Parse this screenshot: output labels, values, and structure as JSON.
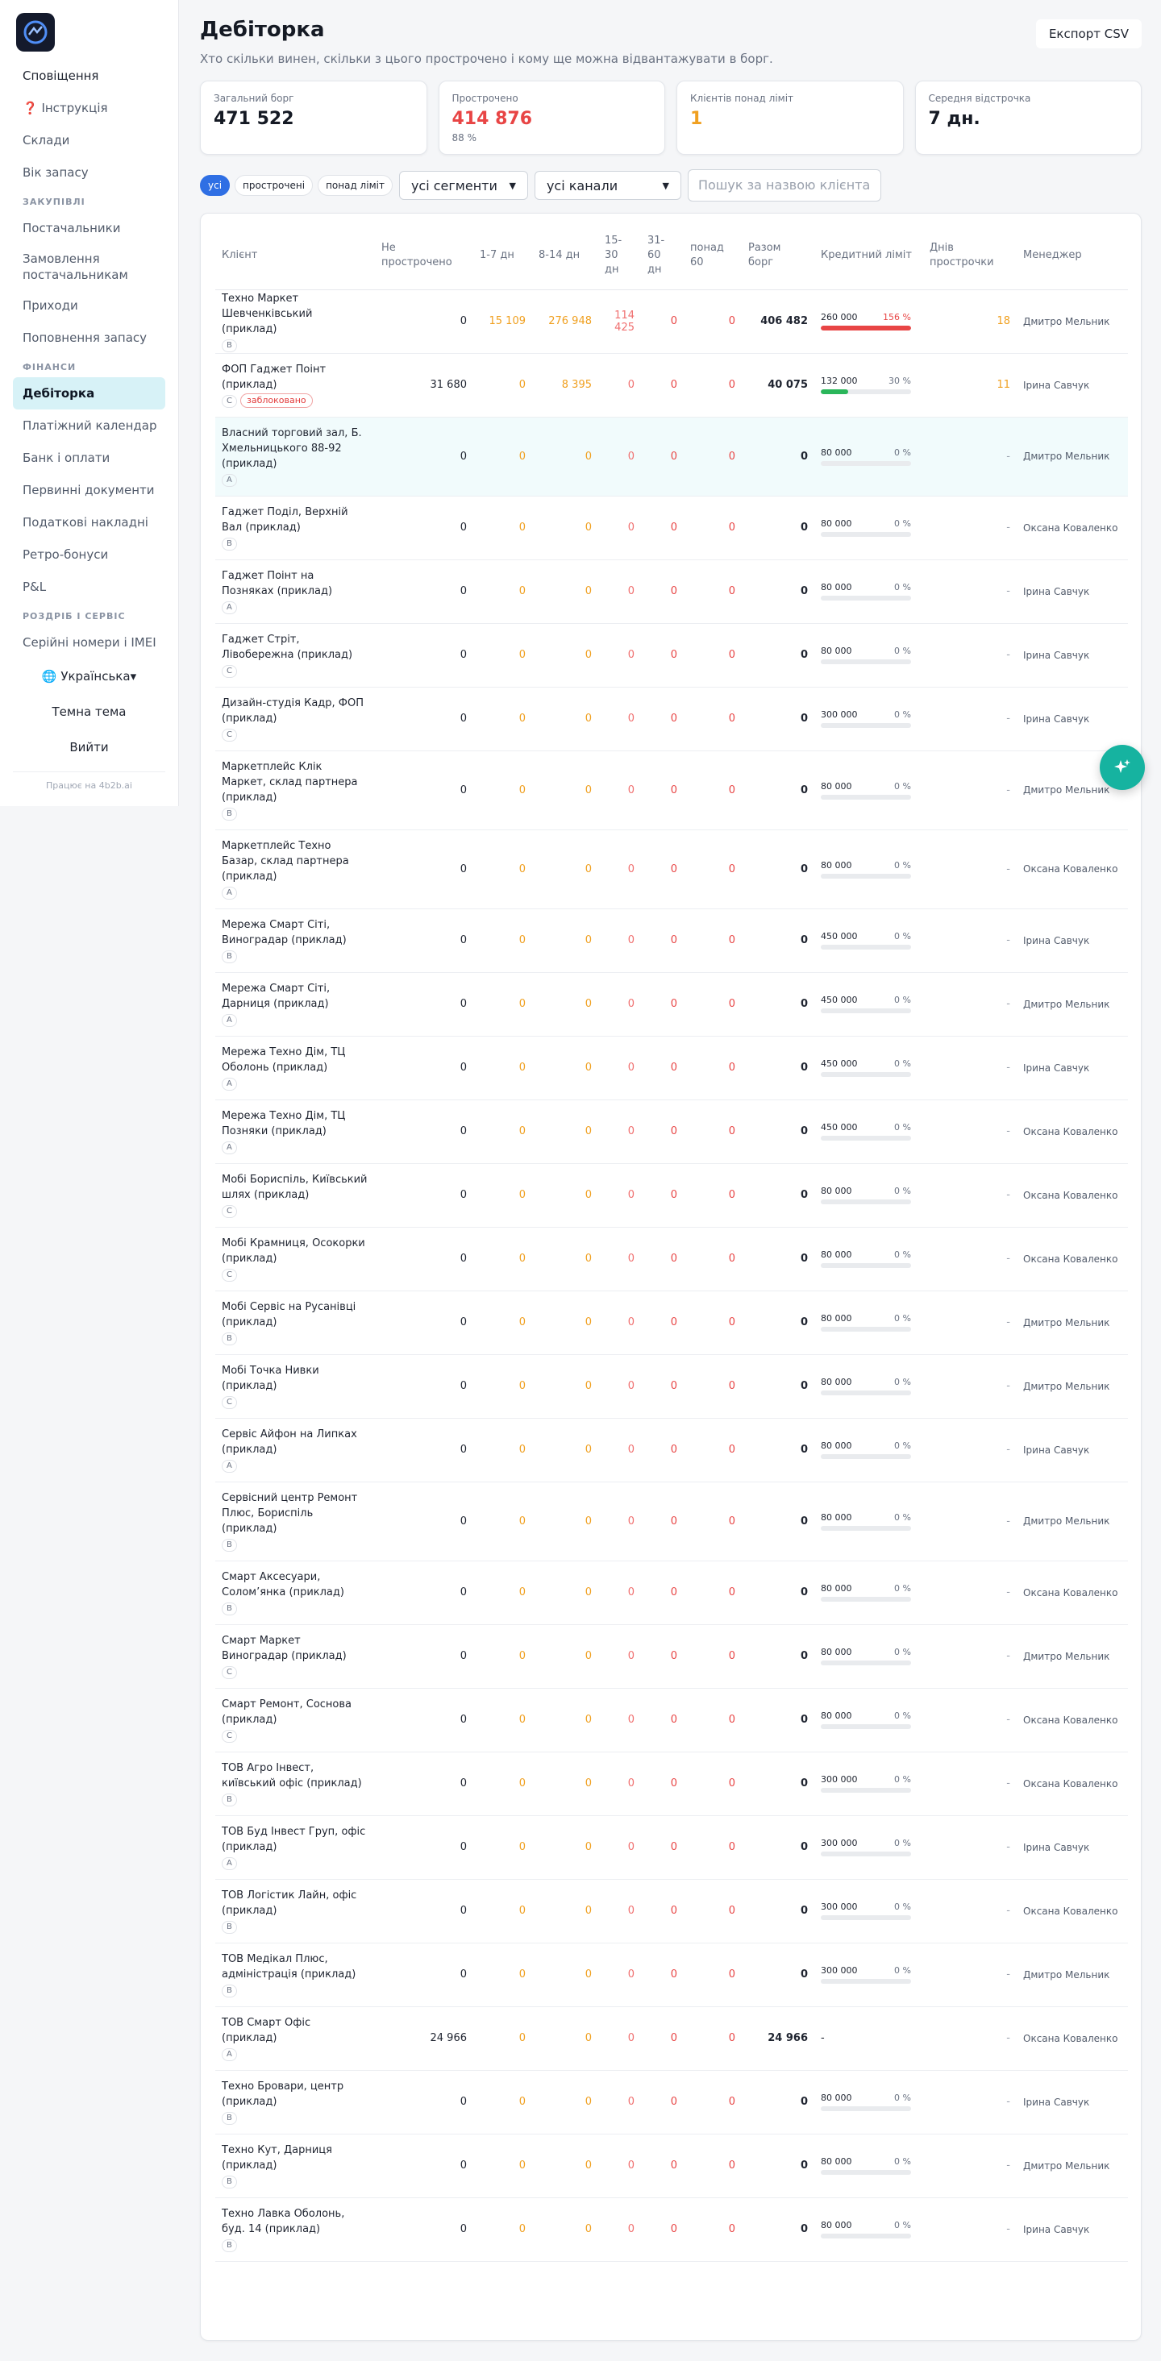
{
  "sidebar": {
    "top_items": [
      {
        "label": "Сповіщення"
      },
      {
        "label": "❓ Інструкція"
      },
      {
        "label": "Склади"
      },
      {
        "label": "Вік запасу"
      }
    ],
    "sections": {
      "procurement": "ЗАКУПІВЛІ",
      "finance": "ФІНАНСИ",
      "returns": "РОЗДРІБ І СЕРВІС"
    },
    "procurement_items": [
      {
        "label": "Постачальники"
      },
      {
        "label": "Замовлення постачальникам"
      },
      {
        "label": "Приходи"
      },
      {
        "label": "Поповнення запасу"
      }
    ],
    "finance_items": [
      {
        "label": "Дебіторка"
      },
      {
        "label": "Платіжний календар"
      },
      {
        "label": "Банк і оплати"
      },
      {
        "label": "Первинні документи"
      },
      {
        "label": "Податкові накладні"
      },
      {
        "label": "Ретро-бонуси"
      },
      {
        "label": "P&L"
      }
    ],
    "retail_items": [
      {
        "label": "Серійні номери і IMEI"
      }
    ],
    "language": "🌐 Українська▾",
    "theme": "Темна тема",
    "logout": "Вийти",
    "footer": "Працює на 4b2b.ai"
  },
  "header": {
    "title": "Дебіторка",
    "subtitle": "Хто скільки винен, скільки з цього прострочено і кому ще можна відвантажувати в борг.",
    "export": "Експорт CSV"
  },
  "kpis": [
    {
      "label": "Загальний борг",
      "value": "471 522",
      "sub": "",
      "color": "#151a24"
    },
    {
      "label": "Прострочено",
      "value": "414 876",
      "sub": "88 %",
      "color": "#e84545"
    },
    {
      "label": "Клієнтів понад ліміт",
      "value": "1",
      "sub": "",
      "color": "#f0a020"
    },
    {
      "label": "Середня відстрочка",
      "value": "7 дн.",
      "sub": "",
      "color": "#151a24"
    }
  ],
  "filters": {
    "pills": [
      {
        "label": "усі"
      },
      {
        "label": "прострочені"
      },
      {
        "label": "понад ліміт"
      }
    ],
    "segment": "усі сегменти",
    "channel": "усі канали",
    "search_placeholder": "Пошук за назвою клієнта"
  },
  "table": {
    "columns": [
      "Клієнт",
      "Не прострочено",
      "1-7 дн",
      "8-14 дн",
      "15-30 дн",
      "31-60 дн",
      "понад 60",
      "Разом борг",
      "Кредитний ліміт",
      "Днів прострочки",
      "Менеджер"
    ],
    "blocked_label": "заблоковано",
    "rows": [
      {
        "client": "Техно Маркет Шевченківський (приклад)",
        "seg": "B",
        "blocked": false,
        "nd": "0",
        "d1": "15 109",
        "d2": "276 948",
        "d3": "114 425",
        "d4": "0",
        "d5": "0",
        "total": "406 482",
        "limit": "260 000",
        "pct": "156 %",
        "ratio": 1.0,
        "days": "18",
        "manager": "Дмитро Мельник",
        "hi": false
      },
      {
        "client": "ФОП Гаджет Поінт (приклад)",
        "seg": "C",
        "blocked": true,
        "nd": "31 680",
        "d1": "0",
        "d2": "8 395",
        "d3": "0",
        "d4": "0",
        "d5": "0",
        "total": "40 075",
        "limit": "132 000",
        "pct": "30 %",
        "ratio": 0.3,
        "days": "11",
        "manager": "Ірина Савчук",
        "hi": false
      },
      {
        "client": "Власний торговий зал, Б. Хмельницького 88-92 (приклад)",
        "seg": "A",
        "blocked": false,
        "nd": "0",
        "d1": "0",
        "d2": "0",
        "d3": "0",
        "d4": "0",
        "d5": "0",
        "total": "0",
        "limit": "80 000",
        "pct": "0 %",
        "ratio": 0,
        "days": "-",
        "manager": "Дмитро Мельник",
        "hi": true
      },
      {
        "client": "Гаджет Поділ, Верхній Вал (приклад)",
        "seg": "B",
        "blocked": false,
        "nd": "0",
        "d1": "0",
        "d2": "0",
        "d3": "0",
        "d4": "0",
        "d5": "0",
        "total": "0",
        "limit": "80 000",
        "pct": "0 %",
        "ratio": 0,
        "days": "-",
        "manager": "Оксана Коваленко",
        "hi": false
      },
      {
        "client": "Гаджет Поінт на Позняках (приклад)",
        "seg": "A",
        "blocked": false,
        "nd": "0",
        "d1": "0",
        "d2": "0",
        "d3": "0",
        "d4": "0",
        "d5": "0",
        "total": "0",
        "limit": "80 000",
        "pct": "0 %",
        "ratio": 0,
        "days": "-",
        "manager": "Ірина Савчук",
        "hi": false
      },
      {
        "client": "Гаджет Стріт, Лівобережна (приклад)",
        "seg": "C",
        "blocked": false,
        "nd": "0",
        "d1": "0",
        "d2": "0",
        "d3": "0",
        "d4": "0",
        "d5": "0",
        "total": "0",
        "limit": "80 000",
        "pct": "0 %",
        "ratio": 0,
        "days": "-",
        "manager": "Ірина Савчук",
        "hi": false
      },
      {
        "client": "Дизайн-студія Кадр, ФОП (приклад)",
        "seg": "C",
        "blocked": false,
        "nd": "0",
        "d1": "0",
        "d2": "0",
        "d3": "0",
        "d4": "0",
        "d5": "0",
        "total": "0",
        "limit": "300 000",
        "pct": "0 %",
        "ratio": 0,
        "days": "-",
        "manager": "Ірина Савчук",
        "hi": false
      },
      {
        "client": "Маркетплейс Клік Маркет, склад партнера (приклад)",
        "seg": "B",
        "blocked": false,
        "nd": "0",
        "d1": "0",
        "d2": "0",
        "d3": "0",
        "d4": "0",
        "d5": "0",
        "total": "0",
        "limit": "80 000",
        "pct": "0 %",
        "ratio": 0,
        "days": "-",
        "manager": "Дмитро Мельник",
        "hi": false
      },
      {
        "client": "Маркетплейс Техно Базар, склад партнера (приклад)",
        "seg": "A",
        "blocked": false,
        "nd": "0",
        "d1": "0",
        "d2": "0",
        "d3": "0",
        "d4": "0",
        "d5": "0",
        "total": "0",
        "limit": "80 000",
        "pct": "0 %",
        "ratio": 0,
        "days": "-",
        "manager": "Оксана Коваленко",
        "hi": false
      },
      {
        "client": "Мережа Смарт Сіті, Виноградар (приклад)",
        "seg": "B",
        "blocked": false,
        "nd": "0",
        "d1": "0",
        "d2": "0",
        "d3": "0",
        "d4": "0",
        "d5": "0",
        "total": "0",
        "limit": "450 000",
        "pct": "0 %",
        "ratio": 0,
        "days": "-",
        "manager": "Ірина Савчук",
        "hi": false
      },
      {
        "client": "Мережа Смарт Сіті, Дарниця (приклад)",
        "seg": "A",
        "blocked": false,
        "nd": "0",
        "d1": "0",
        "d2": "0",
        "d3": "0",
        "d4": "0",
        "d5": "0",
        "total": "0",
        "limit": "450 000",
        "pct": "0 %",
        "ratio": 0,
        "days": "-",
        "manager": "Дмитро Мельник",
        "hi": false
      },
      {
        "client": "Мережа Техно Дім, ТЦ Оболонь (приклад)",
        "seg": "A",
        "blocked": false,
        "nd": "0",
        "d1": "0",
        "d2": "0",
        "d3": "0",
        "d4": "0",
        "d5": "0",
        "total": "0",
        "limit": "450 000",
        "pct": "0 %",
        "ratio": 0,
        "days": "-",
        "manager": "Ірина Савчук",
        "hi": false
      },
      {
        "client": "Мережа Техно Дім, ТЦ Позняки (приклад)",
        "seg": "A",
        "blocked": false,
        "nd": "0",
        "d1": "0",
        "d2": "0",
        "d3": "0",
        "d4": "0",
        "d5": "0",
        "total": "0",
        "limit": "450 000",
        "pct": "0 %",
        "ratio": 0,
        "days": "-",
        "manager": "Оксана Коваленко",
        "hi": false
      },
      {
        "client": "Мобі Бориспіль, Київський шлях (приклад)",
        "seg": "C",
        "blocked": false,
        "nd": "0",
        "d1": "0",
        "d2": "0",
        "d3": "0",
        "d4": "0",
        "d5": "0",
        "total": "0",
        "limit": "80 000",
        "pct": "0 %",
        "ratio": 0,
        "days": "-",
        "manager": "Оксана Коваленко",
        "hi": false
      },
      {
        "client": "Мобі Крамниця, Осокорки (приклад)",
        "seg": "C",
        "blocked": false,
        "nd": "0",
        "d1": "0",
        "d2": "0",
        "d3": "0",
        "d4": "0",
        "d5": "0",
        "total": "0",
        "limit": "80 000",
        "pct": "0 %",
        "ratio": 0,
        "days": "-",
        "manager": "Оксана Коваленко",
        "hi": false
      },
      {
        "client": "Мобі Сервіс на Русанівці (приклад)",
        "seg": "B",
        "blocked": false,
        "nd": "0",
        "d1": "0",
        "d2": "0",
        "d3": "0",
        "d4": "0",
        "d5": "0",
        "total": "0",
        "limit": "80 000",
        "pct": "0 %",
        "ratio": 0,
        "days": "-",
        "manager": "Дмитро Мельник",
        "hi": false
      },
      {
        "client": "Мобі Точка Нивки (приклад)",
        "seg": "C",
        "blocked": false,
        "nd": "0",
        "d1": "0",
        "d2": "0",
        "d3": "0",
        "d4": "0",
        "d5": "0",
        "total": "0",
        "limit": "80 000",
        "pct": "0 %",
        "ratio": 0,
        "days": "-",
        "manager": "Дмитро Мельник",
        "hi": false
      },
      {
        "client": "Сервіс Айфон на Липках (приклад)",
        "seg": "A",
        "blocked": false,
        "nd": "0",
        "d1": "0",
        "d2": "0",
        "d3": "0",
        "d4": "0",
        "d5": "0",
        "total": "0",
        "limit": "80 000",
        "pct": "0 %",
        "ratio": 0,
        "days": "-",
        "manager": "Ірина Савчук",
        "hi": false
      },
      {
        "client": "Сервісний центр Ремонт Плюс, Бориспіль (приклад)",
        "seg": "B",
        "blocked": false,
        "nd": "0",
        "d1": "0",
        "d2": "0",
        "d3": "0",
        "d4": "0",
        "d5": "0",
        "total": "0",
        "limit": "80 000",
        "pct": "0 %",
        "ratio": 0,
        "days": "-",
        "manager": "Дмитро Мельник",
        "hi": false
      },
      {
        "client": "Смарт Аксесуари, Солом’янка (приклад)",
        "seg": "B",
        "blocked": false,
        "nd": "0",
        "d1": "0",
        "d2": "0",
        "d3": "0",
        "d4": "0",
        "d5": "0",
        "total": "0",
        "limit": "80 000",
        "pct": "0 %",
        "ratio": 0,
        "days": "-",
        "manager": "Оксана Коваленко",
        "hi": false
      },
      {
        "client": "Смарт Маркет Виноградар (приклад)",
        "seg": "C",
        "blocked": false,
        "nd": "0",
        "d1": "0",
        "d2": "0",
        "d3": "0",
        "d4": "0",
        "d5": "0",
        "total": "0",
        "limit": "80 000",
        "pct": "0 %",
        "ratio": 0,
        "days": "-",
        "manager": "Дмитро Мельник",
        "hi": false
      },
      {
        "client": "Смарт Ремонт, Соснова (приклад)",
        "seg": "C",
        "blocked": false,
        "nd": "0",
        "d1": "0",
        "d2": "0",
        "d3": "0",
        "d4": "0",
        "d5": "0",
        "total": "0",
        "limit": "80 000",
        "pct": "0 %",
        "ratio": 0,
        "days": "-",
        "manager": "Оксана Коваленко",
        "hi": false
      },
      {
        "client": "ТОВ Агро Інвест, київський офіс (приклад)",
        "seg": "B",
        "blocked": false,
        "nd": "0",
        "d1": "0",
        "d2": "0",
        "d3": "0",
        "d4": "0",
        "d5": "0",
        "total": "0",
        "limit": "300 000",
        "pct": "0 %",
        "ratio": 0,
        "days": "-",
        "manager": "Оксана Коваленко",
        "hi": false
      },
      {
        "client": "ТОВ Буд Інвест Груп, офіс (приклад)",
        "seg": "A",
        "blocked": false,
        "nd": "0",
        "d1": "0",
        "d2": "0",
        "d3": "0",
        "d4": "0",
        "d5": "0",
        "total": "0",
        "limit": "300 000",
        "pct": "0 %",
        "ratio": 0,
        "days": "-",
        "manager": "Ірина Савчук",
        "hi": false
      },
      {
        "client": "ТОВ Логістик Лайн, офіс (приклад)",
        "seg": "B",
        "blocked": false,
        "nd": "0",
        "d1": "0",
        "d2": "0",
        "d3": "0",
        "d4": "0",
        "d5": "0",
        "total": "0",
        "limit": "300 000",
        "pct": "0 %",
        "ratio": 0,
        "days": "-",
        "manager": "Оксана Коваленко",
        "hi": false
      },
      {
        "client": "ТОВ Медікал Плюс, адміністрація (приклад)",
        "seg": "B",
        "blocked": false,
        "nd": "0",
        "d1": "0",
        "d2": "0",
        "d3": "0",
        "d4": "0",
        "d5": "0",
        "total": "0",
        "limit": "300 000",
        "pct": "0 %",
        "ratio": 0,
        "days": "-",
        "manager": "Дмитро Мельник",
        "hi": false
      },
      {
        "client": "ТОВ Смарт Офіс (приклад)",
        "seg": "A",
        "blocked": false,
        "nd": "24 966",
        "d1": "0",
        "d2": "0",
        "d3": "0",
        "d4": "0",
        "d5": "0",
        "total": "24 966",
        "limit": "-",
        "pct": "",
        "ratio": null,
        "days": "-",
        "manager": "Оксана Коваленко",
        "hi": false
      },
      {
        "client": "Техно Бровари, центр (приклад)",
        "seg": "B",
        "blocked": false,
        "nd": "0",
        "d1": "0",
        "d2": "0",
        "d3": "0",
        "d4": "0",
        "d5": "0",
        "total": "0",
        "limit": "80 000",
        "pct": "0 %",
        "ratio": 0,
        "days": "-",
        "manager": "Ірина Савчук",
        "hi": false
      },
      {
        "client": "Техно Кут, Дарниця (приклад)",
        "seg": "B",
        "blocked": false,
        "nd": "0",
        "d1": "0",
        "d2": "0",
        "d3": "0",
        "d4": "0",
        "d5": "0",
        "total": "0",
        "limit": "80 000",
        "pct": "0 %",
        "ratio": 0,
        "days": "-",
        "manager": "Дмитро Мельник",
        "hi": false
      },
      {
        "client": "Техно Лавка Оболонь, буд. 14 (приклад)",
        "seg": "B",
        "blocked": false,
        "nd": "0",
        "d1": "0",
        "d2": "0",
        "d3": "0",
        "d4": "0",
        "d5": "0",
        "total": "0",
        "limit": "80 000",
        "pct": "0 %",
        "ratio": 0,
        "days": "-",
        "manager": "Ірина Савчук",
        "hi": false
      }
    ]
  },
  "colors": {
    "accent": "#2f6fe4",
    "danger": "#e84545",
    "warning": "#f0a020",
    "ok": "#2ab65a",
    "active_bg": "#d7f2f7",
    "fab": "#16b3a0"
  },
  "icons": {
    "logo": "app-logo-icon",
    "fab": "sparkle-icon",
    "select": "chevron-down-icon"
  }
}
